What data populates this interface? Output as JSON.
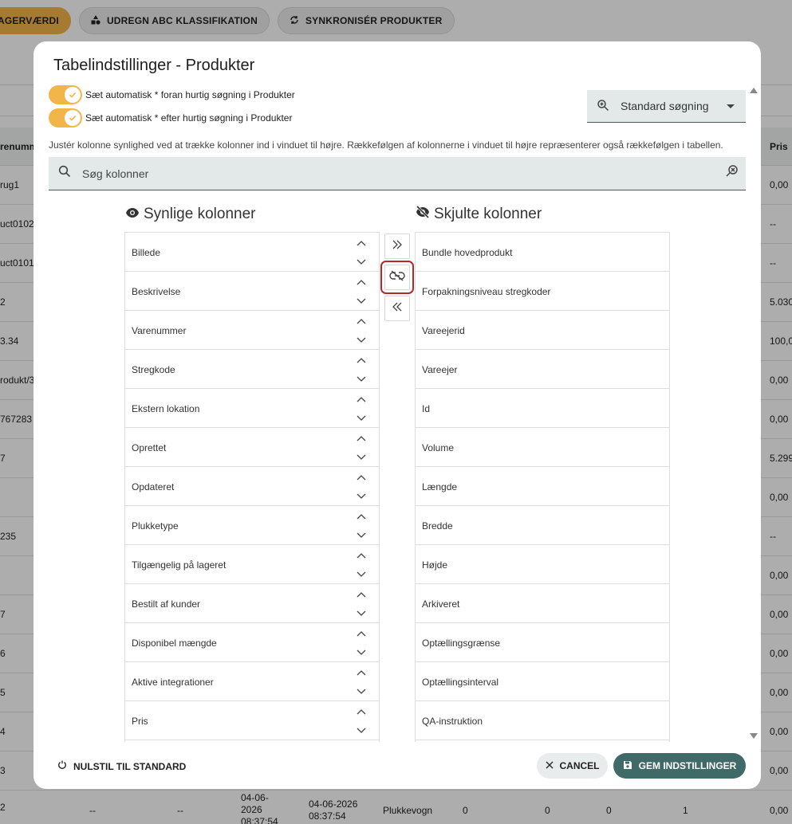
{
  "background": {
    "toolbar": [
      {
        "label": "AGERVÆRDI",
        "icon": "none"
      },
      {
        "label": "UDREGN ABC KLASSIFIKATION",
        "icon": "shapes-icon"
      },
      {
        "label": "SYNKRONISÉR PRODUKTER",
        "icon": "sync-icon"
      }
    ],
    "header_left": "renumm",
    "header_right": "Pris",
    "rows": [
      {
        "left": "rug1",
        "right": "0,00"
      },
      {
        "left": "uct0102",
        "right": "--"
      },
      {
        "left": "uct0101",
        "right": "--"
      },
      {
        "left": "2",
        "right": "5.030"
      },
      {
        "left": "3.34",
        "right": "100,0"
      },
      {
        "left": "rodukt/3",
        "right": "0,00"
      },
      {
        "left": "767283",
        "right": "0,00"
      },
      {
        "left": "7",
        "right": "5.299"
      },
      {
        "left": "",
        "right": "0,00"
      },
      {
        "left": "235",
        "right": "--"
      },
      {
        "left": "",
        "right": "0,00"
      },
      {
        "left": "7",
        "right": "0,00"
      },
      {
        "left": "6",
        "right": "0,00"
      },
      {
        "left": "5",
        "right": "0,00"
      },
      {
        "left": "4",
        "right": "0,00"
      },
      {
        "left": "3",
        "right": "0,00"
      }
    ],
    "last_row": {
      "c1": "2",
      "c2": "--",
      "c3": "--",
      "c4": "04-06-2026 08:37:54",
      "c5": "04-06-2026 08:37:54",
      "c6": "Plukkevogn",
      "c7": "0",
      "c8": "0",
      "c9": "0",
      "c10": "1",
      "c11": "0,00"
    }
  },
  "dialog": {
    "title": "Tabelindstillinger - Produkter",
    "toggles": [
      {
        "label": "Sæt automatisk * foran hurtig søgning i Produkter",
        "checked": true
      },
      {
        "label": "Sæt automatisk * efter hurtig søgning i Produkter",
        "checked": true
      }
    ],
    "search_mode": "Standard søgning",
    "hint": "Justér kolonne synlighed ved at trække kolonner ind i vinduet til højre. Rækkefølgen af kolonnerne i vinduet til højre repræsenterer også rækkefølgen i tabellen.",
    "column_search_placeholder": "Søg kolonner",
    "visible_title": "Synlige kolonner",
    "hidden_title": "Skjulte kolonner",
    "visible_columns": [
      "Billede",
      "Beskrivelse",
      "Varenummer",
      "Stregkode",
      "Ekstern lokation",
      "Oprettet",
      "Opdateret",
      "Plukketype",
      "Tilgængelig på lageret",
      "Bestilt af kunder",
      "Disponibel mængde",
      "Aktive integrationer",
      "Pris"
    ],
    "hidden_columns": [
      "Bundle hovedprodukt",
      "Forpakningsniveau stregkoder",
      "Vareejerid",
      "Vareejer",
      "Id",
      "Volume",
      "Længde",
      "Bredde",
      "Højde",
      "Arkiveret",
      "Optællingsgrænse",
      "Optællingsinterval",
      "QA-instruktion"
    ],
    "reset_label": "NULSTIL TIL STANDARD",
    "cancel_label": "CANCEL",
    "save_label": "GEM INDSTILLINGER"
  },
  "colors": {
    "accent": "#f2b549",
    "primary": "#3f6a67",
    "highlight": "#b02a2a"
  }
}
